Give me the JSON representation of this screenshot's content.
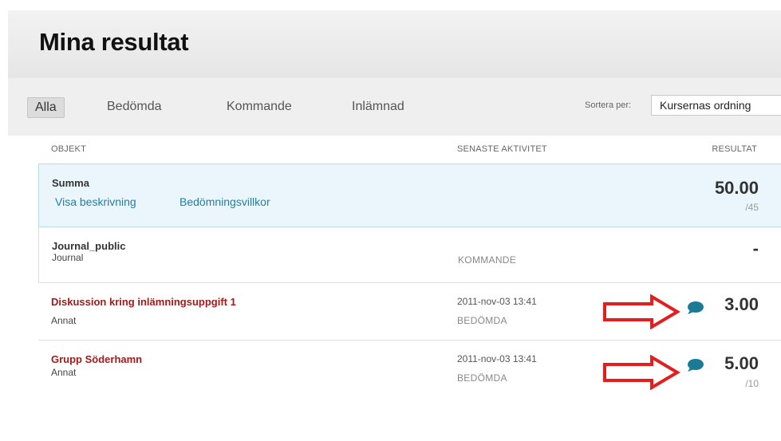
{
  "header": {
    "title": "Mina resultat"
  },
  "filters": {
    "tabs": [
      {
        "label": "Alla",
        "active": true
      },
      {
        "label": "Bedömda",
        "active": false
      },
      {
        "label": "Kommande",
        "active": false
      },
      {
        "label": "Inlämnad",
        "active": false
      }
    ],
    "sort_label": "Sortera per:",
    "sort_value": "Kursernas ordning"
  },
  "columns": {
    "item": "OBJEKT",
    "activity": "SENASTE AKTIVITET",
    "result": "RESULTAT"
  },
  "summary": {
    "name": "Summa",
    "link_description": "Visa beskrivning",
    "link_rules": "Bedömningsvillkor",
    "score": "50.00",
    "max": "/45"
  },
  "rows": [
    {
      "name": "Journal_public",
      "type": "Journal",
      "date": "",
      "status": "KOMMANDE",
      "score": "-",
      "max": "",
      "has_comment": false
    },
    {
      "name": "Diskussion kring inlämningsuppgift 1",
      "type": "Annat",
      "date": "2011-nov-03 13:41",
      "status": "BEDÖMDA",
      "score": "3.00",
      "max": "",
      "has_comment": true
    },
    {
      "name": "Grupp Söderhamn",
      "type": "Annat",
      "date": "2011-nov-03 13:41",
      "status": "BEDÖMDA",
      "score": "5.00",
      "max": "/10",
      "has_comment": true
    }
  ],
  "colors": {
    "accent_link": "#1f7fa6",
    "item_red": "#a01c1c",
    "annotation_arrow": "#e41e1e",
    "comment_icon": "#1b7b96"
  },
  "icons": {
    "comment": "comment-bubble-icon",
    "annotation": "right-arrow-annotation"
  }
}
